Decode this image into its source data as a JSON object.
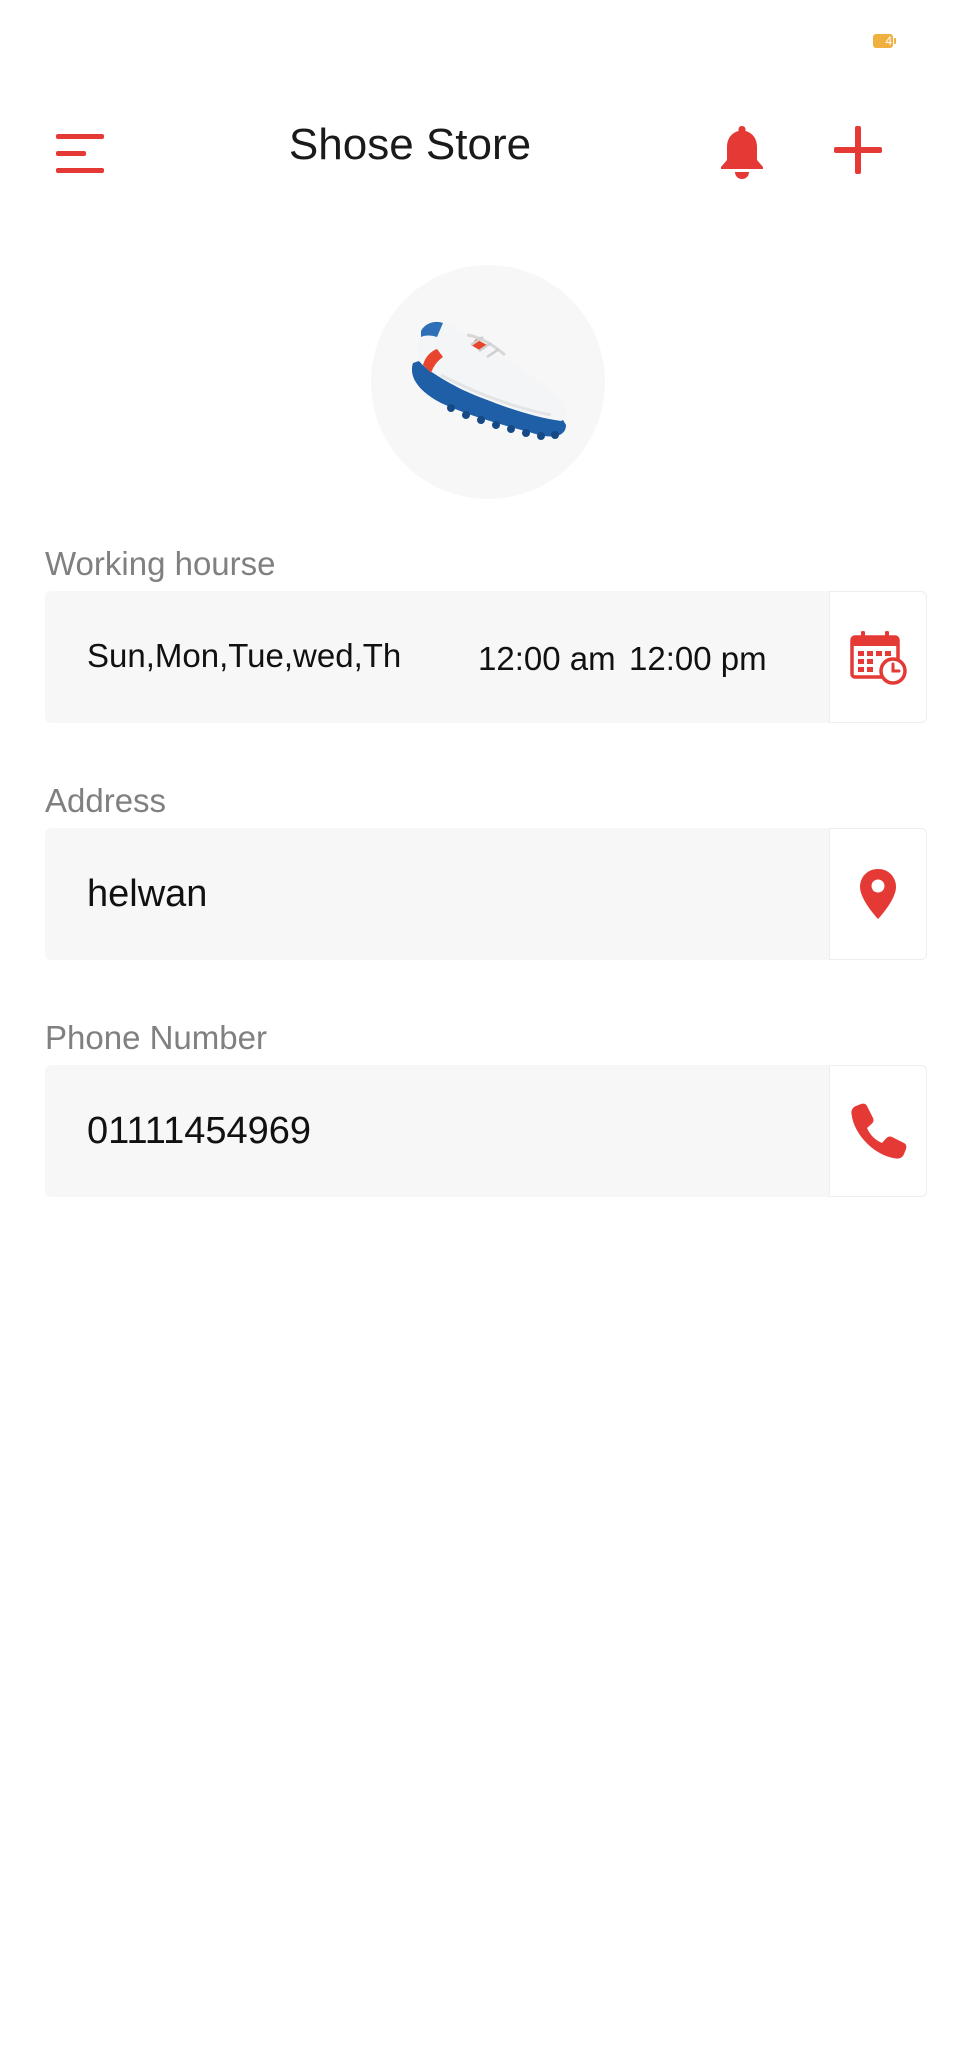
{
  "status_bar": {
    "battery_level": "4"
  },
  "app_bar": {
    "title": "Shose Store",
    "menu_icon": "menu-icon",
    "notification_icon": "bell-icon",
    "add_icon": "plus-icon"
  },
  "store": {
    "image": "shoe-image"
  },
  "working_hours": {
    "label": "Working hourse",
    "days": "Sun,Mon,Tue,wed,Th",
    "open_time": "12:00 am",
    "close_time": "12:00 pm",
    "icon": "calendar-clock-icon"
  },
  "address": {
    "label": "Address",
    "value": "helwan",
    "icon": "location-pin-icon"
  },
  "phone": {
    "label": "Phone Number",
    "value": "01111454969",
    "icon": "phone-icon"
  },
  "colors": {
    "accent": "#e53935",
    "field_bg": "#f7f7f7",
    "label": "#808080",
    "text": "#111111",
    "battery": "#f0b040"
  }
}
